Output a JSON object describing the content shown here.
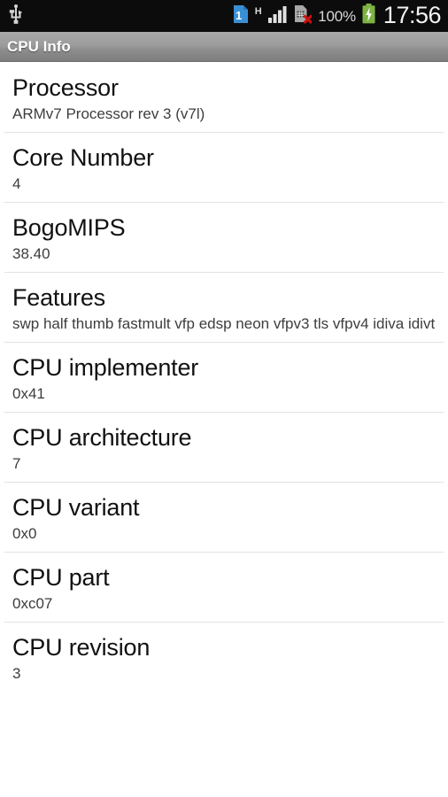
{
  "statusbar": {
    "left_icons": [
      {
        "name": "usb-icon",
        "label": "USB"
      }
    ],
    "right_icons": [
      {
        "name": "sim-card-1-icon",
        "label": "1"
      },
      {
        "name": "network-type-indicator",
        "label": "H"
      },
      {
        "name": "signal-bars-icon",
        "label": "signal"
      },
      {
        "name": "sim-card-missing-icon",
        "label": "no sim"
      }
    ],
    "battery_percent": "100%",
    "battery_state_icon": "battery-charging-icon",
    "clock": "17:56",
    "background_color": "#0c0c0c",
    "battery_color": "#7cb342",
    "sim_color": "#3a8fd4",
    "error_color": "#cc1111"
  },
  "actionbar": {
    "title": "CPU Info"
  },
  "list": {
    "rows": [
      {
        "title": "Processor",
        "value": "ARMv7 Processor rev 3 (v7l)"
      },
      {
        "title": "Core Number",
        "value": "4"
      },
      {
        "title": "BogoMIPS",
        "value": "38.40"
      },
      {
        "title": "Features",
        "value": "swp half thumb fastmult vfp edsp neon vfpv3 tls vfpv4 idiva idivt"
      },
      {
        "title": "CPU implementer",
        "value": "0x41"
      },
      {
        "title": "CPU architecture",
        "value": "7"
      },
      {
        "title": "CPU variant",
        "value": "0x0"
      },
      {
        "title": "CPU part",
        "value": "0xc07"
      },
      {
        "title": "CPU revision",
        "value": "3"
      }
    ]
  }
}
